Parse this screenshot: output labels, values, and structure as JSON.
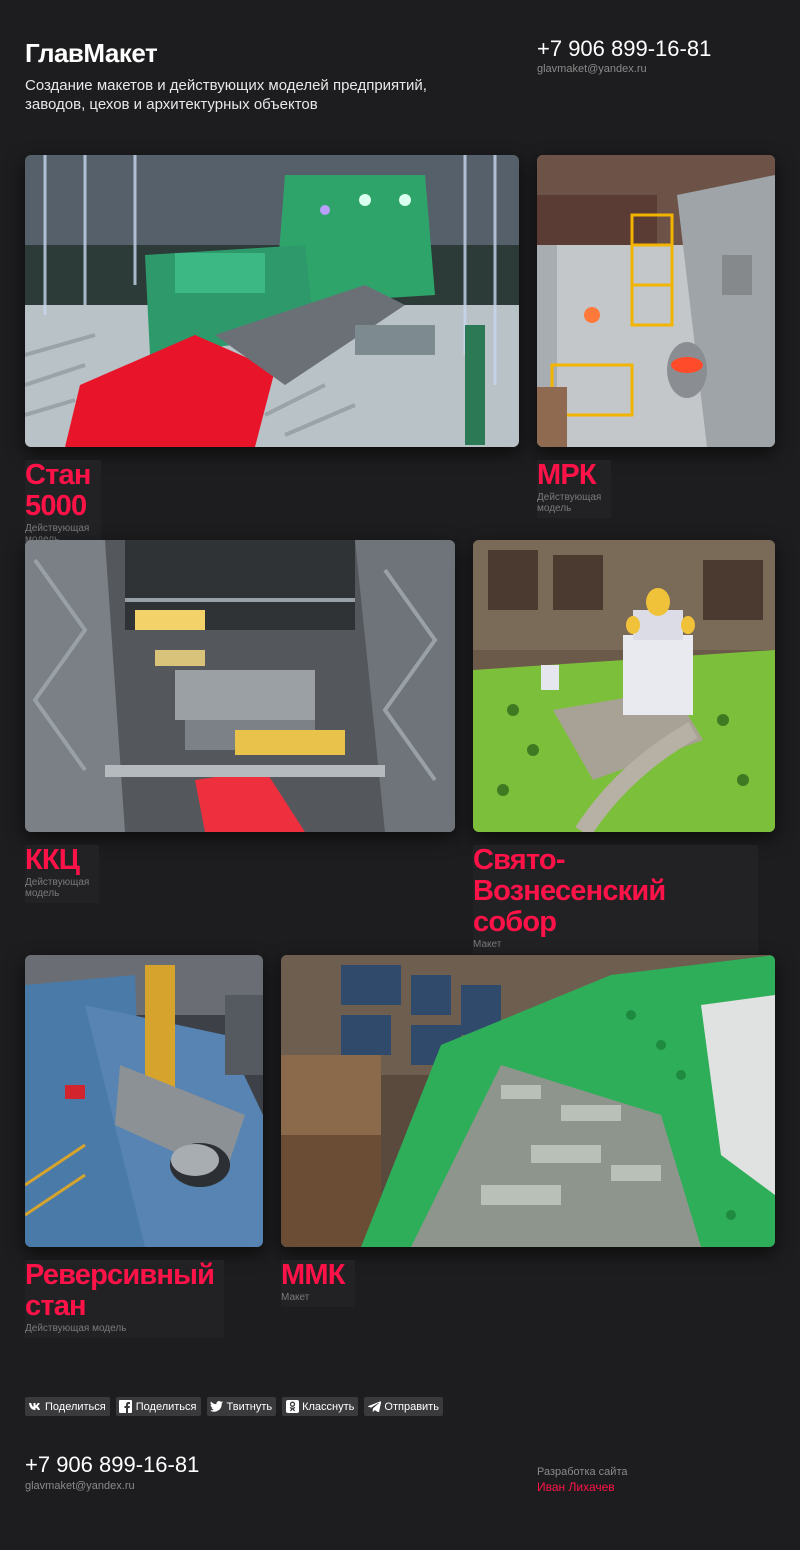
{
  "header": {
    "brand": "ГлавМакет",
    "tagline": "Создание макетов и действующих моделей предприятий, заводов, цехов и архитектурных объектов",
    "phone": "+7 906 899-16-81",
    "email": "glavmaket@yandex.ru"
  },
  "projects": [
    {
      "title": "Стан 5000",
      "subtitle": "Действующая модель",
      "image": "rolling-mill-model-photo"
    },
    {
      "title": "МРК",
      "subtitle": "Действующая модель",
      "image": "steel-workshop-model-photo"
    },
    {
      "title": "ККЦ",
      "subtitle": "Действующая модель",
      "image": "converter-shop-model-photo"
    },
    {
      "title": "Свято-Вознесенский собор",
      "subtitle": "Макет",
      "image": "cathedral-model-photo"
    },
    {
      "title": "Реверсивный стан",
      "subtitle": "Действующая модель",
      "image": "reversing-mill-model-photo"
    },
    {
      "title": "ММК",
      "subtitle": "Макет",
      "image": "plant-layout-model-photo"
    }
  ],
  "share": [
    {
      "label": "Поделиться",
      "icon": "vk-icon"
    },
    {
      "label": "Поделиться",
      "icon": "facebook-icon"
    },
    {
      "label": "Твитнуть",
      "icon": "twitter-icon"
    },
    {
      "label": "Класснуть",
      "icon": "odnoklassniki-icon"
    },
    {
      "label": "Отправить",
      "icon": "telegram-icon"
    }
  ],
  "footer": {
    "phone": "+7 906 899-16-81",
    "email": "glavmaket@yandex.ru",
    "dev_label": "Разработка сайта",
    "dev_name": "Иван Лихачев"
  },
  "colors": {
    "background": "#1d1d1f",
    "accent": "#ff1248",
    "muted": "#8a8a8a",
    "button": "#3a3a3d"
  }
}
